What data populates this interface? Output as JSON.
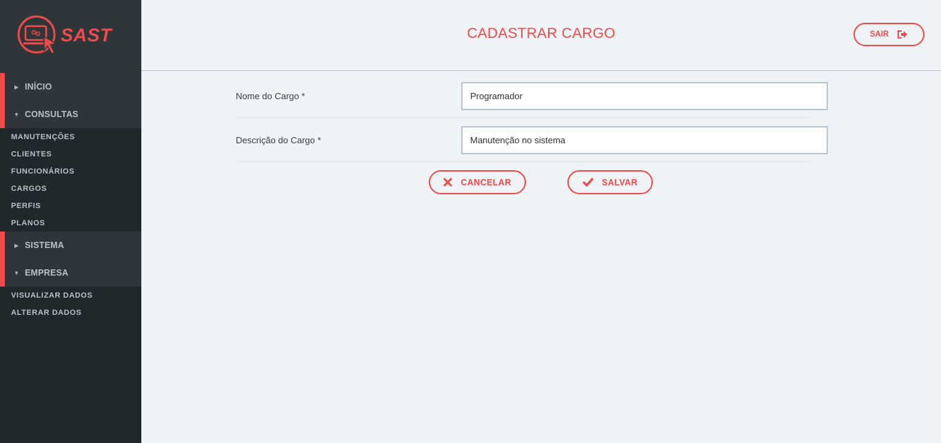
{
  "brand": {
    "name": "SAST",
    "accent": "#f04a4a"
  },
  "sidebar": {
    "groups": [
      {
        "label": "INÍCIO",
        "expanded": false
      },
      {
        "label": "CONSULTAS",
        "expanded": true,
        "items": [
          "MANUTENÇÕES",
          "CLIENTES",
          "FUNCIONÁRIOS",
          "CARGOS",
          "PERFIS",
          "PLANOS"
        ]
      },
      {
        "label": "SISTEMA",
        "expanded": false
      },
      {
        "label": "EMPRESA",
        "expanded": true,
        "items": [
          "VISUALIZAR DADOS",
          "ALTERAR DADOS"
        ]
      }
    ]
  },
  "header": {
    "title": "CADASTRAR CARGO",
    "logout_label": "SAIR"
  },
  "form": {
    "fields": [
      {
        "label": "Nome do Cargo *",
        "value": "Programador"
      },
      {
        "label": "Descrição do Cargo *",
        "value": "Manutenção no sistema"
      }
    ],
    "cancel_label": "CANCELAR",
    "save_label": "SALVAR"
  }
}
